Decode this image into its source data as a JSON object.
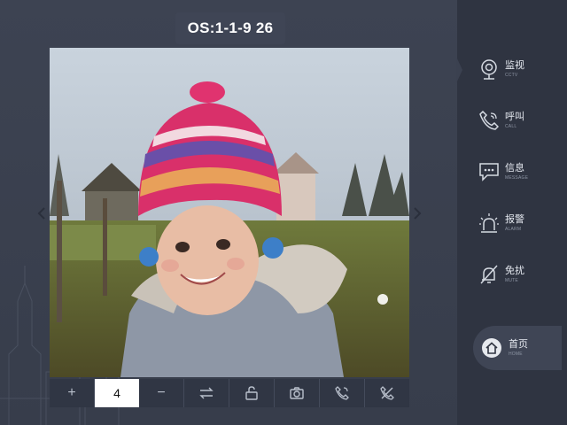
{
  "header": {
    "title": "OS:1-1-9  26"
  },
  "video": {
    "description_icon": "camera-feed"
  },
  "toolbar": {
    "plus_label": "+",
    "value": "4",
    "minus_label": "−",
    "icons": [
      "swap-icon",
      "unlock-icon",
      "snapshot-icon",
      "call-icon",
      "hangup-icon"
    ]
  },
  "sidebar": {
    "items": [
      {
        "label": "监视",
        "sub": "CCTV",
        "icon": "cctv-icon"
      },
      {
        "label": "呼叫",
        "sub": "CALL",
        "icon": "phone-icon"
      },
      {
        "label": "信息",
        "sub": "MESSAGE",
        "icon": "message-icon"
      },
      {
        "label": "报警",
        "sub": "ALARM",
        "icon": "alarm-icon"
      },
      {
        "label": "免扰",
        "sub": "MUTE",
        "icon": "mute-icon"
      }
    ],
    "home": {
      "label": "首页",
      "sub": "HOME",
      "icon": "home-icon"
    }
  },
  "colors": {
    "background": "#3b4150",
    "sidebar": "#2f3441",
    "accent": "#ffffff"
  }
}
